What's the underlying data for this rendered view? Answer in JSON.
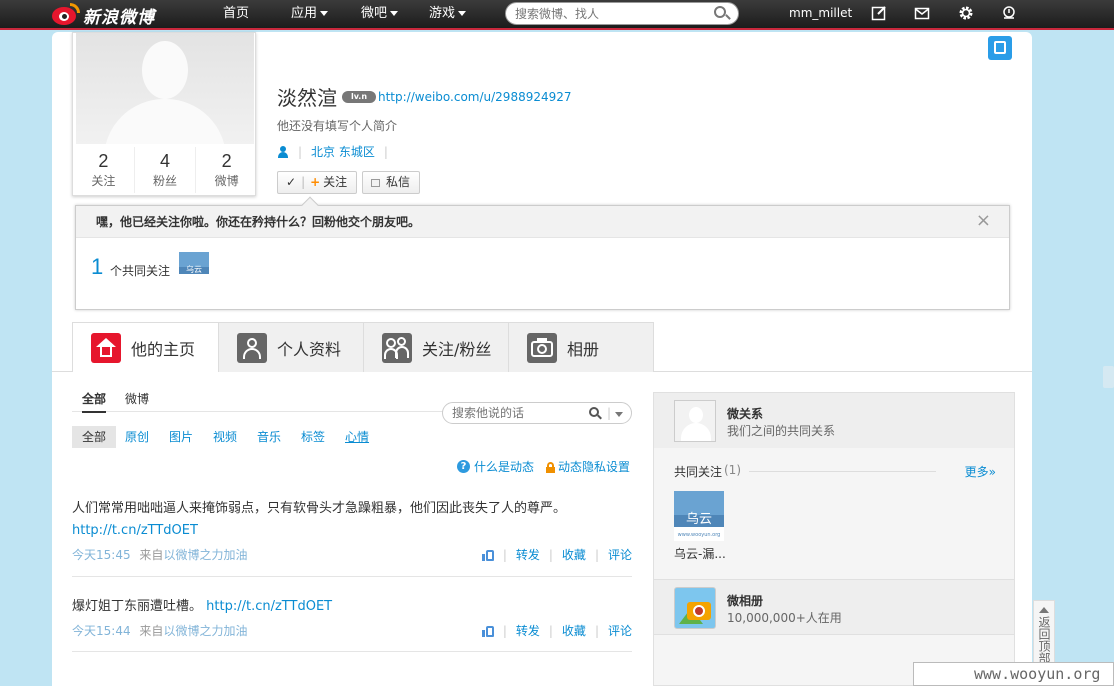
{
  "topnav": {
    "logo_text": "新浪微博",
    "items": [
      {
        "label": "首页",
        "has_caret": false
      },
      {
        "label": "应用",
        "has_caret": true
      },
      {
        "label": "微吧",
        "has_caret": true
      },
      {
        "label": "游戏",
        "has_caret": true
      }
    ],
    "search_placeholder": "搜索微博、找人",
    "username": "mm_millet",
    "icons": [
      "compose-icon",
      "mail-icon",
      "gear-icon",
      "bell-icon"
    ]
  },
  "profile": {
    "name": "淡然渲",
    "level_badge": "lv.n",
    "url": "http://weibo.com/u/2988924927",
    "intro": "他还没有填写个人简介",
    "location": "北京 东城区",
    "location_sep": "|",
    "stats": [
      {
        "value": "2",
        "label": "关注"
      },
      {
        "value": "4",
        "label": "粉丝"
      },
      {
        "value": "2",
        "label": "微博"
      }
    ],
    "follow_button": {
      "check": "✓",
      "sep": "|",
      "plus": "+",
      "label": "关注"
    },
    "message_button": "私信"
  },
  "notice": {
    "text": "嘿，他已经关注你啦。你还在矜持什么？回粉他交个朋友吧。",
    "close": "×",
    "common_count": "1",
    "common_label": "个共同关注",
    "common_user_logo_text": "乌云"
  },
  "tabs": [
    {
      "label": "他的主页",
      "active": true,
      "icon": "home-icon"
    },
    {
      "label": "个人资料",
      "active": false,
      "icon": "profile-icon"
    },
    {
      "label": "关注/粉丝",
      "active": false,
      "icon": "follow-icon"
    },
    {
      "label": "相册",
      "active": false,
      "icon": "camera-icon"
    }
  ],
  "feed": {
    "subtabs": [
      {
        "label": "全部",
        "active": true
      },
      {
        "label": "微博",
        "active": false
      }
    ],
    "search_placeholder": "搜索他说的话",
    "search_sep": "|",
    "filters": [
      {
        "label": "全部",
        "active": true
      },
      {
        "label": "原创",
        "active": false
      },
      {
        "label": "图片",
        "active": false
      },
      {
        "label": "视频",
        "active": false
      },
      {
        "label": "音乐",
        "active": false
      },
      {
        "label": "标签",
        "active": false
      },
      {
        "label": "心情",
        "active": false
      }
    ],
    "help_link": "什么是动态",
    "privacy_link": "动态隐私设置",
    "posts": [
      {
        "text": "人们常常用咄咄逼人来掩饰弱点，只有软骨头才急躁粗暴，他们因此丧失了人的尊严。",
        "link": "http://t.cn/zTTdOET",
        "time": "今天15:45",
        "from": "来自",
        "source": "以微博之力加油",
        "actions": [
          "转发",
          "收藏",
          "评论"
        ]
      },
      {
        "text": "爆灯姐丁东丽遭吐槽。",
        "link": "http://t.cn/zTTdOET",
        "time": "今天15:44",
        "from": "来自",
        "source": "以微博之力加油",
        "actions": [
          "转发",
          "收藏",
          "评论"
        ]
      }
    ],
    "action_sep": "|"
  },
  "sidebar": {
    "relation_title": "微关系",
    "relation_sub": "我们之间的共同关系",
    "common_follow_title": "共同关注",
    "common_follow_count": "(1)",
    "more_link": "更多»",
    "common_user_logo_text": "乌云",
    "common_user_logo_sub": "www.wooyun.org",
    "common_user_name": "乌云-漏...",
    "album_title": "微相册",
    "album_sub": "10,000,000+人在用"
  },
  "back_to_top": "返回顶部",
  "watermark": "www.wooyun.org"
}
